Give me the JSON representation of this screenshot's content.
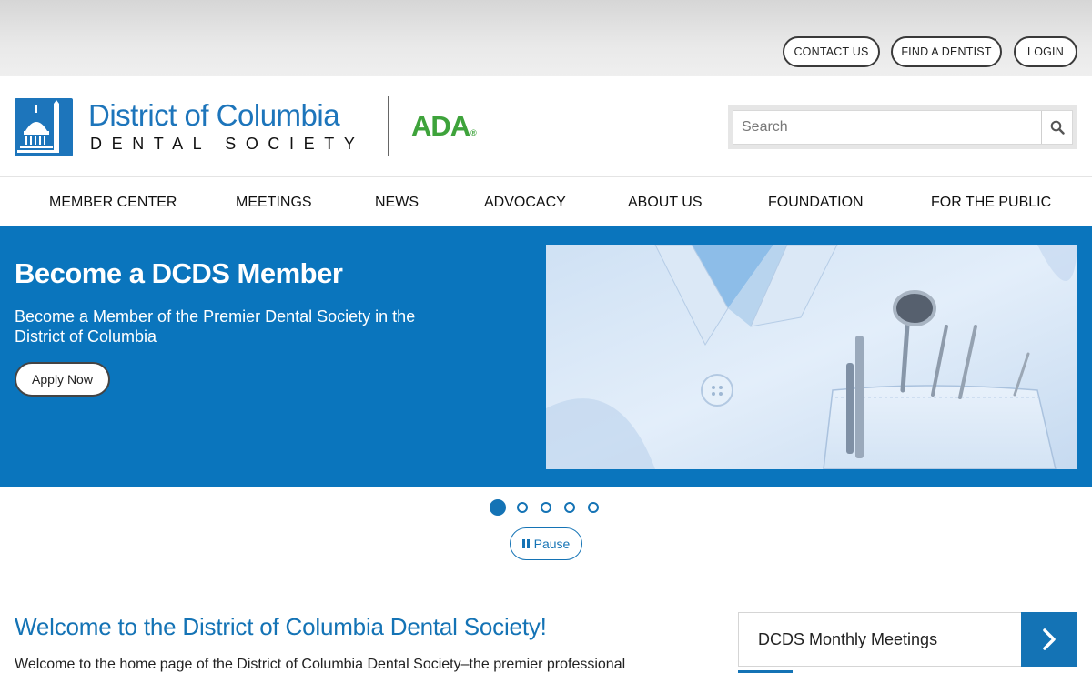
{
  "utility": {
    "contact": "CONTACT US",
    "find_dentist": "FIND A DENTIST",
    "login": "LOGIN"
  },
  "header": {
    "logo_title": "District of Columbia",
    "logo_subtitle": "DENTAL SOCIETY",
    "ada": "ADA",
    "ada_mark": "®",
    "search_placeholder": "Search"
  },
  "nav": {
    "items": [
      "MEMBER CENTER",
      "MEETINGS",
      "NEWS",
      "ADVOCACY",
      "ABOUT US",
      "FOUNDATION",
      "FOR THE PUBLIC"
    ]
  },
  "hero": {
    "title": "Become a DCDS Member",
    "text": "Become a Member of the Premier Dental Society in the District of Columbia",
    "button": "Apply Now"
  },
  "carousel": {
    "slide_count": 5,
    "active_slide": 1,
    "pause_label": "Pause"
  },
  "welcome": {
    "title": "Welcome to the District of Columbia Dental Society!",
    "text": "Welcome to the home page of the District of Columbia Dental Society–the premier professional"
  },
  "sidebar": {
    "meetings_label": "DCDS Monthly Meetings"
  },
  "colors": {
    "brand_blue": "#1d75bb",
    "hero_blue": "#0a75bd",
    "ada_green": "#3ea33b"
  }
}
